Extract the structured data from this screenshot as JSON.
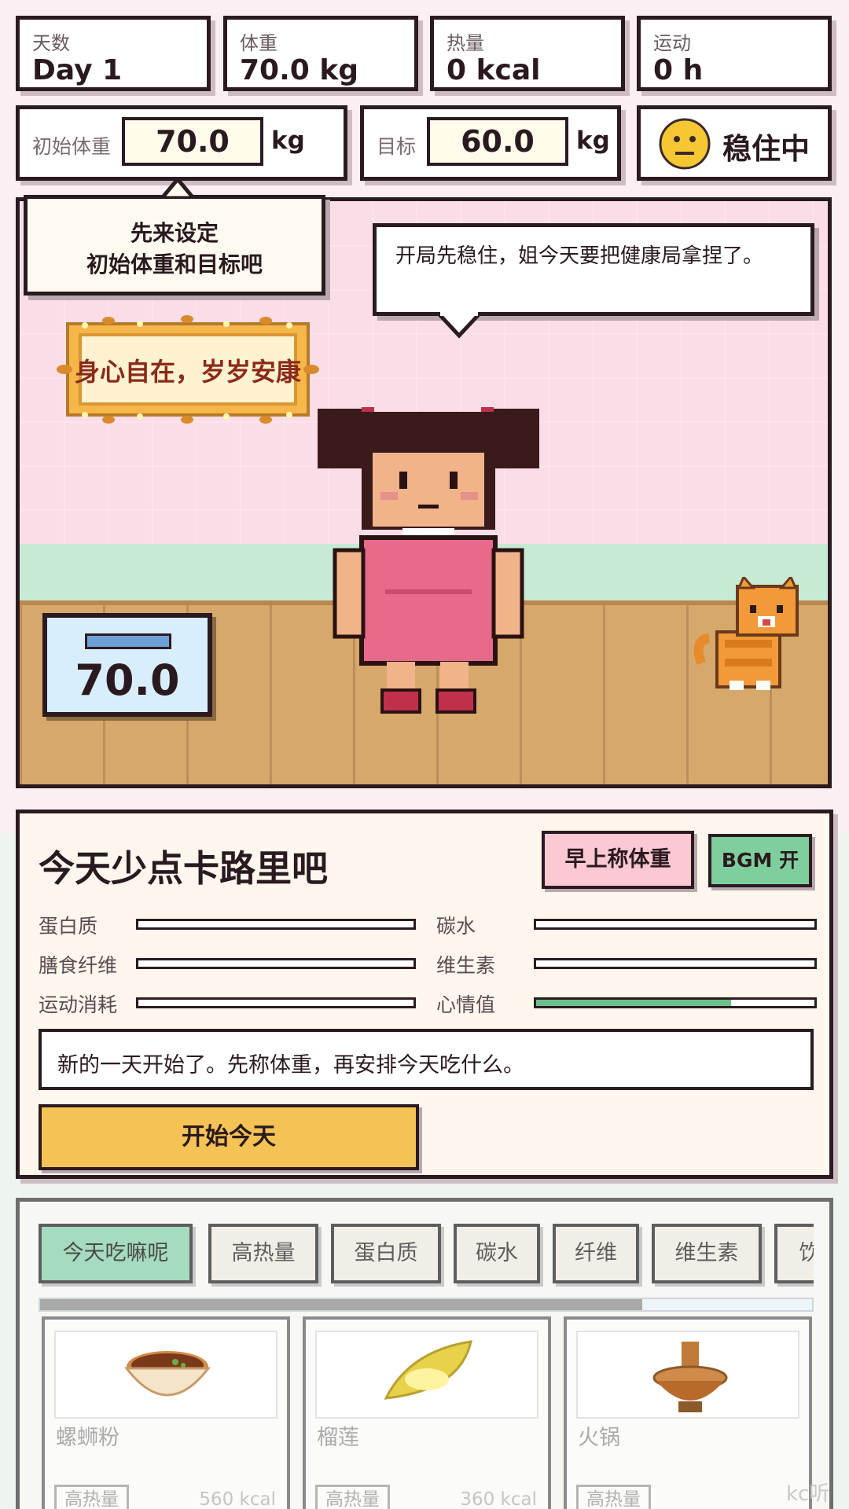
{
  "stats": [
    {
      "label": "天数",
      "value": "Day 1"
    },
    {
      "label": "体重",
      "value": "70.0 kg"
    },
    {
      "label": "热量",
      "value": "0 kcal"
    },
    {
      "label": "运动",
      "value": "0 h"
    }
  ],
  "settings": {
    "initial_label": "初始体重",
    "initial_value": "70.0",
    "initial_unit": "kg",
    "target_label": "目标",
    "target_value": "60.0",
    "target_unit": "kg",
    "status": "稳住中"
  },
  "scene": {
    "tip_line1": "先来设定",
    "tip_line2": "初始体重和目标吧",
    "speech": "开局先稳住，姐今天要把健康局拿捏了。",
    "banner": "身心自在，岁岁安康",
    "scale_value": "70.0"
  },
  "panel": {
    "title": "今天少点卡路里吧",
    "weigh_button": "早上称体重",
    "bgm_button": "BGM 开",
    "bars": [
      {
        "label": "蛋白质",
        "value": 0
      },
      {
        "label": "碳水",
        "value": 0
      },
      {
        "label": "膳食纤维",
        "value": 0
      },
      {
        "label": "维生素",
        "value": 0
      },
      {
        "label": "运动消耗",
        "value": 0
      },
      {
        "label": "心情值",
        "value": 0.7
      }
    ],
    "message": "新的一天开始了。先称体重，再安排今天吃什么。",
    "start_button": "开始今天"
  },
  "food": {
    "tabs": [
      "今天吃嘛呢",
      "高热量",
      "蛋白质",
      "碳水",
      "纤维",
      "维生素",
      "饮"
    ],
    "scroll_progress": 0.78,
    "items": [
      {
        "name": "螺蛳粉",
        "tag": "高热量",
        "kcal": "560 kcal"
      },
      {
        "name": "榴莲",
        "tag": "高热量",
        "kcal": "360 kcal"
      },
      {
        "name": "火锅",
        "tag": "高热量",
        "kcal": ""
      }
    ]
  },
  "watermark": "kc听下载",
  "colors": {
    "accent_green": "#6cc08b",
    "start_yellow": "#f5c255",
    "weigh_pink": "#fbc8d3",
    "bgm_green": "#7fcf9e"
  }
}
